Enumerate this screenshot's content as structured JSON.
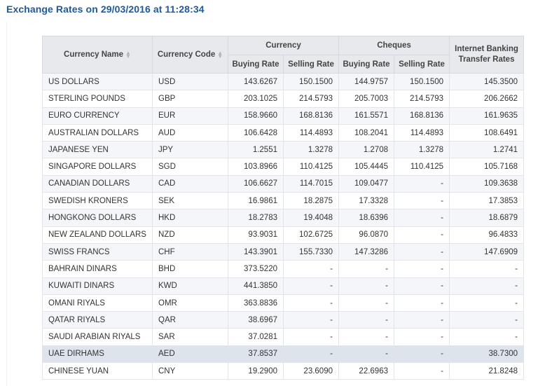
{
  "title": "Exchange Rates on 29/03/2016 at 11:28:34",
  "headers": {
    "currency_name": "Currency Name",
    "currency_code": "Currency Code",
    "currency_group": "Currency",
    "cheques_group": "Cheques",
    "internet_banking_line1": "Internet Banking",
    "internet_banking_line2": "Transfer Rates",
    "buying_rate": "Buying Rate",
    "selling_rate": "Selling Rate"
  },
  "icons": {
    "sort": "sort-icon"
  },
  "rows": [
    {
      "name": "US DOLLARS",
      "code": "USD",
      "cur_buy": "143.6267",
      "cur_sell": "150.1500",
      "chq_buy": "144.9757",
      "chq_sell": "150.1500",
      "ib": "145.3500"
    },
    {
      "name": "STERLING POUNDS",
      "code": "GBP",
      "cur_buy": "203.1025",
      "cur_sell": "214.5793",
      "chq_buy": "205.7003",
      "chq_sell": "214.5793",
      "ib": "206.2662"
    },
    {
      "name": "EURO CURRENCY",
      "code": "EUR",
      "cur_buy": "158.9660",
      "cur_sell": "168.8136",
      "chq_buy": "161.5571",
      "chq_sell": "168.8136",
      "ib": "161.9635"
    },
    {
      "name": "AUSTRALIAN DOLLARS",
      "code": "AUD",
      "cur_buy": "106.6428",
      "cur_sell": "114.4893",
      "chq_buy": "108.2041",
      "chq_sell": "114.4893",
      "ib": "108.6491"
    },
    {
      "name": "JAPANESE YEN",
      "code": "JPY",
      "cur_buy": "1.2551",
      "cur_sell": "1.3278",
      "chq_buy": "1.2708",
      "chq_sell": "1.3278",
      "ib": "1.2741"
    },
    {
      "name": "SINGAPORE DOLLARS",
      "code": "SGD",
      "cur_buy": "103.8966",
      "cur_sell": "110.4125",
      "chq_buy": "105.4445",
      "chq_sell": "110.4125",
      "ib": "105.7168"
    },
    {
      "name": "CANADIAN DOLLARS",
      "code": "CAD",
      "cur_buy": "106.6627",
      "cur_sell": "114.7015",
      "chq_buy": "109.0477",
      "chq_sell": "-",
      "ib": "109.3638"
    },
    {
      "name": "SWEDISH KRONERS",
      "code": "SEK",
      "cur_buy": "16.9861",
      "cur_sell": "18.2875",
      "chq_buy": "17.3328",
      "chq_sell": "-",
      "ib": "17.3853"
    },
    {
      "name": "HONGKONG DOLLARS",
      "code": "HKD",
      "cur_buy": "18.2783",
      "cur_sell": "19.4048",
      "chq_buy": "18.6396",
      "chq_sell": "-",
      "ib": "18.6879"
    },
    {
      "name": "NEW ZEALAND DOLLARS",
      "code": "NZD",
      "cur_buy": "93.9031",
      "cur_sell": "102.6725",
      "chq_buy": "96.0870",
      "chq_sell": "-",
      "ib": "96.4833"
    },
    {
      "name": "SWISS FRANCS",
      "code": "CHF",
      "cur_buy": "143.3901",
      "cur_sell": "155.7330",
      "chq_buy": "147.3286",
      "chq_sell": "-",
      "ib": "147.6909"
    },
    {
      "name": "BAHRAIN DINARS",
      "code": "BHD",
      "cur_buy": "373.5220",
      "cur_sell": "-",
      "chq_buy": "-",
      "chq_sell": "-",
      "ib": "-"
    },
    {
      "name": "KUWAITI DINARS",
      "code": "KWD",
      "cur_buy": "441.3850",
      "cur_sell": "-",
      "chq_buy": "-",
      "chq_sell": "-",
      "ib": "-"
    },
    {
      "name": "OMANI RIYALS",
      "code": "OMR",
      "cur_buy": "363.8836",
      "cur_sell": "-",
      "chq_buy": "-",
      "chq_sell": "-",
      "ib": "-"
    },
    {
      "name": "QATAR RIYALS",
      "code": "QAR",
      "cur_buy": "38.6967",
      "cur_sell": "-",
      "chq_buy": "-",
      "chq_sell": "-",
      "ib": "-"
    },
    {
      "name": "SAUDI ARABIAN RIYALS",
      "code": "SAR",
      "cur_buy": "37.0281",
      "cur_sell": "-",
      "chq_buy": "-",
      "chq_sell": "-",
      "ib": "-"
    },
    {
      "name": "UAE DIRHAMS",
      "code": "AED",
      "cur_buy": "37.8537",
      "cur_sell": "-",
      "chq_buy": "-",
      "chq_sell": "-",
      "ib": "38.7300"
    },
    {
      "name": "CHINESE YUAN",
      "code": "CNY",
      "cur_buy": "19.2900",
      "cur_sell": "23.6090",
      "chq_buy": "22.6963",
      "chq_sell": "-",
      "ib": "21.8248"
    }
  ],
  "highlighted_row_code": "AED",
  "colors": {
    "title": "#1a5aa6",
    "header_bg": "#e7e9ec",
    "alt_row_bg": "#f4f6f9",
    "highlight_row_bg": "#dde4ec"
  }
}
